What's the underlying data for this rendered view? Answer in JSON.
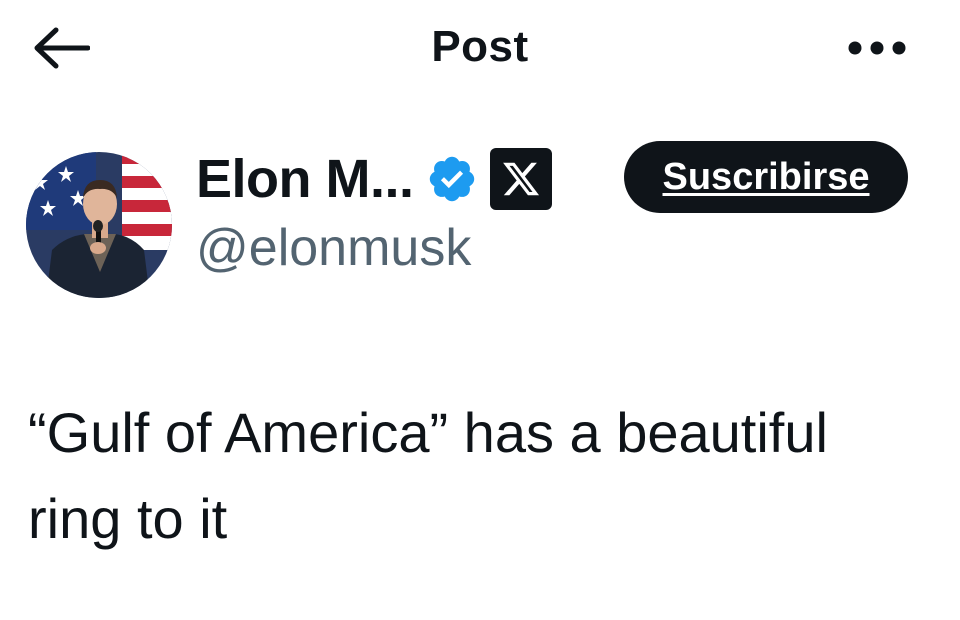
{
  "header": {
    "title": "Post",
    "back_icon": "arrow-left-icon",
    "more_icon": "more-horizontal-icon"
  },
  "author": {
    "display_name": "Elon M...",
    "handle": "@elonmusk",
    "verified_icon": "verified-badge-icon",
    "verified_color": "#1d9bf0",
    "affiliate_badge_icon": "x-logo-icon"
  },
  "subscribe_button": {
    "label": "Suscribirse"
  },
  "post": {
    "text": "“Gulf of America” has a beautiful ring to it"
  },
  "colors": {
    "text_primary": "#0f1419",
    "text_secondary": "#536471",
    "button_bg": "#0f1419",
    "background": "#ffffff"
  }
}
